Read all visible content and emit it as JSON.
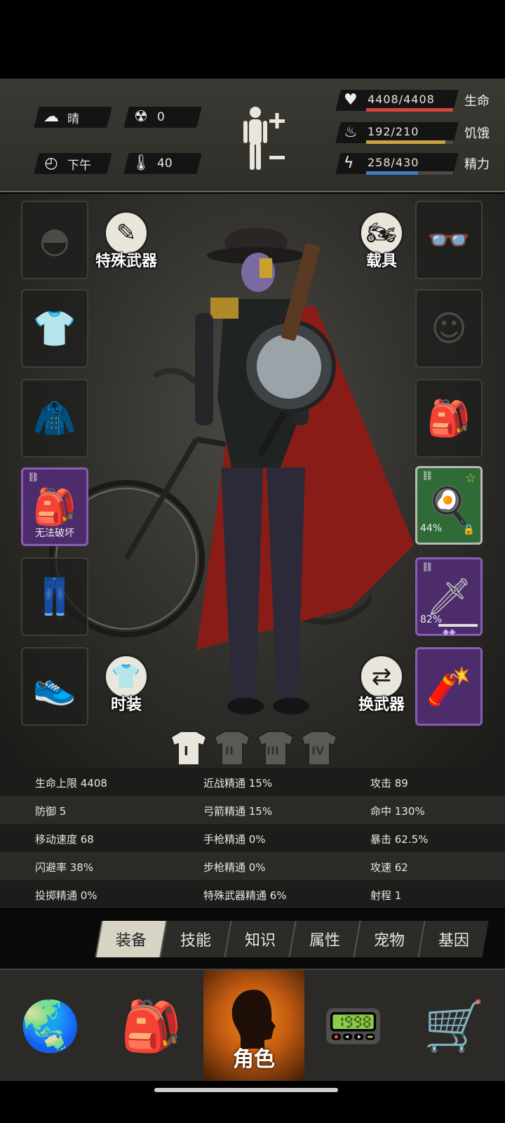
{
  "status": {
    "weather": "晴",
    "radiation": "0",
    "time_of_day": "下午",
    "temperature": "40"
  },
  "vitals": [
    {
      "label": "生命",
      "value": "4408/4408",
      "fill": 1.0,
      "color": "#d4473d",
      "icon": "heart-icon"
    },
    {
      "label": "饥饿",
      "value": "192/210",
      "fill": 0.914,
      "color": "#c9a24a",
      "icon": "stomach-icon"
    },
    {
      "label": "精力",
      "value": "258/430",
      "fill": 0.6,
      "color": "#3f7cc4",
      "icon": "energy-icon"
    }
  ],
  "scene": {
    "special_weapon_label": "特殊武器",
    "vehicle_label": "载具",
    "fashion_label": "时装",
    "swap_weapon_label": "换武器",
    "backpack_slot_text": "无法破坏",
    "weapon1_durability": "44%",
    "weapon2_durability": "82%",
    "outfit_tabs": [
      "I",
      "II",
      "III",
      "IV"
    ]
  },
  "stats": [
    [
      "生命上限 4408",
      "近战精通 15%",
      "攻击 89"
    ],
    [
      "防御 5",
      "弓箭精通 15%",
      "命中 130%"
    ],
    [
      "移动速度 68",
      "手枪精通 0%",
      "暴击 62.5%"
    ],
    [
      "闪避率 38%",
      "步枪精通 0%",
      "攻速 62"
    ],
    [
      "投掷精通 0%",
      "特殊武器精通 6%",
      "射程 1"
    ]
  ],
  "tabs": [
    "装备",
    "技能",
    "知识",
    "属性",
    "宠物",
    "基因"
  ],
  "nav": {
    "active_label": "角色"
  }
}
